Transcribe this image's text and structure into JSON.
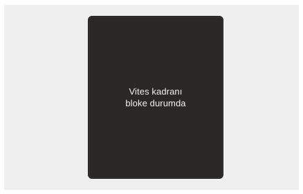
{
  "display": {
    "message_line1": "Vites kadranı",
    "message_line2": "bloke durumda"
  },
  "colors": {
    "background": "#efefef",
    "screen": "#2a2826",
    "text": "#f2f2f2"
  }
}
